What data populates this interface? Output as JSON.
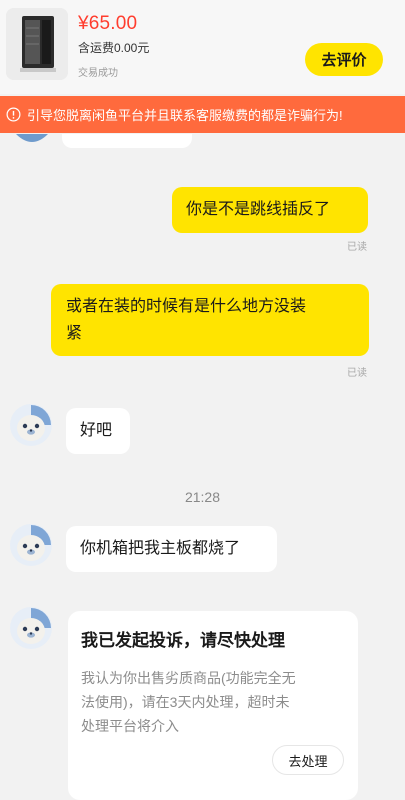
{
  "order": {
    "price": "¥65.00",
    "shipping": "含运费0.00元",
    "status": "交易成功",
    "review_button": "去评价"
  },
  "warning_banner": {
    "icon": "info-circle-icon",
    "text": "引导您脱离闲鱼平台并且联系客服缴费的都是诈骗行为!"
  },
  "messages": [
    {
      "from": "me",
      "text": "你是不是跳线插反了",
      "receipt": "已读"
    },
    {
      "from": "me",
      "text_line1": "或者在装的时候有是什么地方没装",
      "text_line2": "紧",
      "receipt": "已读"
    },
    {
      "from": "them",
      "text": "好吧",
      "avatar": "seal-mascot-avatar"
    },
    {
      "time": "21:28"
    },
    {
      "from": "them",
      "text": "你机箱把我主板都烧了",
      "avatar": "seal-mascot-avatar"
    }
  ],
  "complaint_card": {
    "title": "我已发起投诉，请尽快处理",
    "body_line1": "我认为你出售劣质商品(功能完全无",
    "body_line2": "法使用)，请在3天内处理，超时未",
    "body_line3": "处理平台将介入",
    "action_button": "去处理"
  },
  "colors": {
    "accent_yellow": "#ffe400",
    "price_red": "#ff3d2e",
    "warning_orange": "#ff6a3d",
    "background": "#f2f2f2"
  }
}
